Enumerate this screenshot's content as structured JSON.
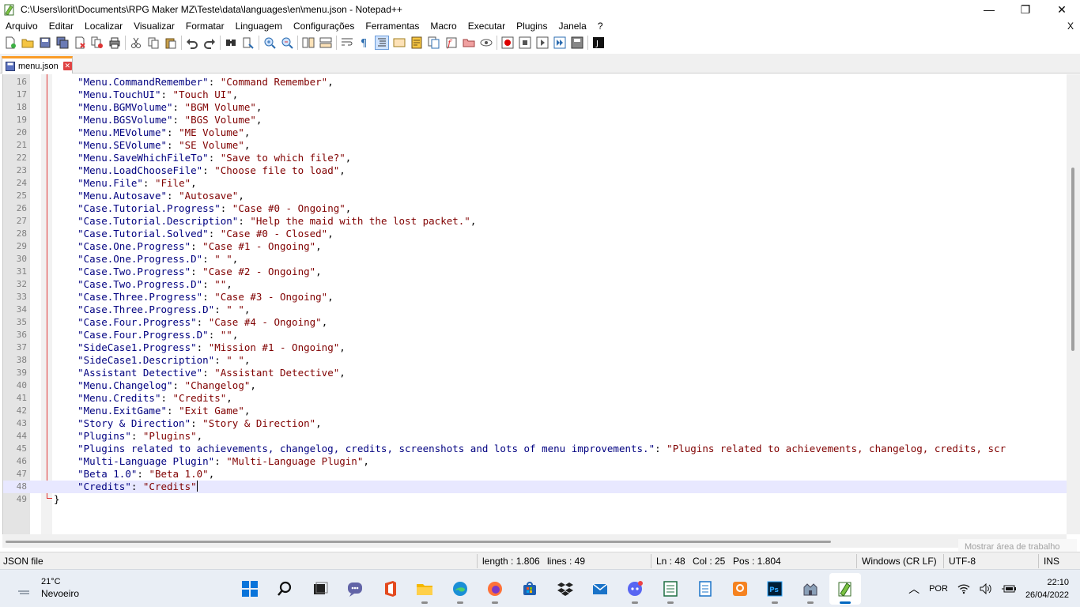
{
  "window": {
    "title": "C:\\Users\\lorit\\Documents\\RPG Maker MZ\\Teste\\data\\languages\\en\\menu.json - Notepad++",
    "minimize": "—",
    "maximize": "❐",
    "close": "✕"
  },
  "menu": {
    "items": [
      "Arquivo",
      "Editar",
      "Localizar",
      "Visualizar",
      "Formatar",
      "Linguagem",
      "Configurações",
      "Ferramentas",
      "Macro",
      "Executar",
      "Plugins",
      "Janela",
      "?"
    ],
    "close": "X"
  },
  "tab": {
    "name": "menu.json",
    "close": "✕"
  },
  "editor": {
    "lines": [
      {
        "n": "16",
        "key": "\"Menu.CommandRemember\"",
        "val": "\"Command Remember\"",
        "end": ","
      },
      {
        "n": "17",
        "key": "\"Menu.TouchUI\"",
        "val": "\"Touch UI\"",
        "end": ","
      },
      {
        "n": "18",
        "key": "\"Menu.BGMVolume\"",
        "val": "\"BGM Volume\"",
        "end": ","
      },
      {
        "n": "19",
        "key": "\"Menu.BGSVolume\"",
        "val": "\"BGS Volume\"",
        "end": ","
      },
      {
        "n": "20",
        "key": "\"Menu.MEVolume\"",
        "val": "\"ME Volume\"",
        "end": ","
      },
      {
        "n": "21",
        "key": "\"Menu.SEVolume\"",
        "val": "\"SE Volume\"",
        "end": ","
      },
      {
        "n": "22",
        "key": "\"Menu.SaveWhichFileTo\"",
        "val": "\"Save to which file?\"",
        "end": ","
      },
      {
        "n": "23",
        "key": "\"Menu.LoadChooseFile\"",
        "val": "\"Choose file to load\"",
        "end": ","
      },
      {
        "n": "24",
        "key": "\"Menu.File\"",
        "val": "\"File\"",
        "end": ","
      },
      {
        "n": "25",
        "key": "\"Menu.Autosave\"",
        "val": "\"Autosave\"",
        "end": ","
      },
      {
        "n": "26",
        "key": "\"Case.Tutorial.Progress\"",
        "val": "\"Case #0 - Ongoing\"",
        "end": ","
      },
      {
        "n": "27",
        "key": "\"Case.Tutorial.Description\"",
        "val": "\"Help the maid with the lost packet.\"",
        "end": ","
      },
      {
        "n": "28",
        "key": "\"Case.Tutorial.Solved\"",
        "val": "\"Case #0 - Closed\"",
        "end": ","
      },
      {
        "n": "29",
        "key": "\"Case.One.Progress\"",
        "val": "\"Case #1 - Ongoing\"",
        "end": ","
      },
      {
        "n": "30",
        "key": "\"Case.One.Progress.D\"",
        "val": "\" \"",
        "end": ","
      },
      {
        "n": "31",
        "key": "\"Case.Two.Progress\"",
        "val": "\"Case #2 - Ongoing\"",
        "end": ","
      },
      {
        "n": "32",
        "key": "\"Case.Two.Progress.D\"",
        "val": "\"\"",
        "end": ","
      },
      {
        "n": "33",
        "key": "\"Case.Three.Progress\"",
        "val": "\"Case #3 - Ongoing\"",
        "end": ","
      },
      {
        "n": "34",
        "key": "\"Case.Three.Progress.D\"",
        "val": "\" \"",
        "end": ","
      },
      {
        "n": "35",
        "key": "\"Case.Four.Progress\"",
        "val": "\"Case #4 - Ongoing\"",
        "end": ","
      },
      {
        "n": "36",
        "key": "\"Case.Four.Progress.D\"",
        "val": "\"\"",
        "end": ","
      },
      {
        "n": "37",
        "key": "\"SideCase1.Progress\"",
        "val": "\"Mission #1 - Ongoing\"",
        "end": ","
      },
      {
        "n": "38",
        "key": "\"SideCase1.Description\"",
        "val": "\" \"",
        "end": ","
      },
      {
        "n": "39",
        "key": "\"Assistant Detective\"",
        "val": "\"Assistant Detective\"",
        "end": ","
      },
      {
        "n": "40",
        "key": "\"Menu.Changelog\"",
        "val": "\"Changelog\"",
        "end": ","
      },
      {
        "n": "41",
        "key": "\"Menu.Credits\"",
        "val": "\"Credits\"",
        "end": ","
      },
      {
        "n": "42",
        "key": "\"Menu.ExitGame\"",
        "val": "\"Exit Game\"",
        "end": ","
      },
      {
        "n": "43",
        "key": "\"Story & Direction\"",
        "val": "\"Story & Direction\"",
        "end": ","
      },
      {
        "n": "44",
        "key": "\"Plugins\"",
        "val": "\"Plugins\"",
        "end": ","
      },
      {
        "n": "45",
        "key": "\"Plugins related to achievements, changelog, credits, screenshots and lots of menu improvements.\"",
        "val": "\"Plugins related to achievements, changelog, credits, scr",
        "end": ""
      },
      {
        "n": "46",
        "key": "\"Multi-Language Plugin\"",
        "val": "\"Multi-Language Plugin\"",
        "end": ","
      },
      {
        "n": "47",
        "key": "\"Beta 1.0\"",
        "val": "\"Beta 1.0\"",
        "end": ","
      },
      {
        "n": "48",
        "key": "\"Credits\"",
        "val": "\"Credits\"",
        "end": ""
      }
    ],
    "last_line": {
      "n": "49",
      "text": "}"
    },
    "current_line": "48"
  },
  "desktop_hint": "Mostrar área de trabalho",
  "status": {
    "filetype": "JSON file",
    "length": "length : 1.806",
    "lines": "lines : 49",
    "ln": "Ln : 48",
    "col": "Col : 25",
    "pos": "Pos : 1.804",
    "eol": "Windows (CR LF)",
    "encoding": "UTF-8",
    "mode": "INS"
  },
  "taskbar": {
    "weather_temp": "21°C",
    "weather_desc": "Nevoeiro",
    "apps": [
      "windows-start-icon",
      "search-icon",
      "task-view-icon",
      "teams-chat-icon",
      "office-icon",
      "file-explorer-icon",
      "edge-icon",
      "firefox-icon",
      "microsoft-store-icon",
      "dropbox-icon",
      "mail-icon",
      "discord-icon",
      "excel-icon",
      "notes-icon",
      "pdf-app-icon",
      "photoshop-icon",
      "rpg-maker-icon",
      "notepad-plus-plus-icon"
    ],
    "active_app": "notepad-plus-plus-icon",
    "language": "POR",
    "time": "22:10",
    "date": "26/04/2022"
  },
  "colors": {
    "json_key": "#000080",
    "json_string": "#800000",
    "tab_accent": "#fa9c28",
    "current_line": "#e8e8ff",
    "taskbar_bg": "#e9eef5"
  }
}
